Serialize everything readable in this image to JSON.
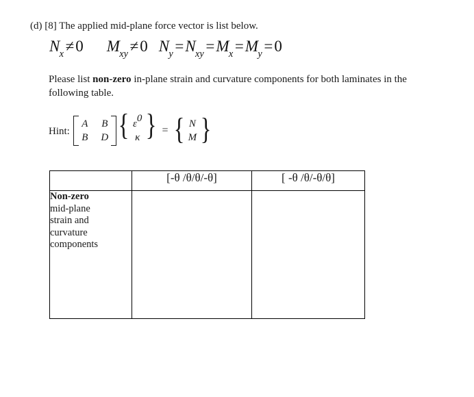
{
  "document": {
    "question_prefix": "(d) [8] The applied mid-plane force vector is list below.",
    "instruction_part1": "Please list ",
    "instruction_bold": "non-zero",
    "instruction_part2": " in-plane strain and curvature components for both laminates in the following table.",
    "hint_label": "Hint:"
  },
  "force_equation": {
    "term1": {
      "symbol": "N",
      "subscript": "x",
      "operator": "≠",
      "value": "0"
    },
    "term2": {
      "symbol": "M",
      "subscript": "xy",
      "operator": "≠",
      "value": "0"
    },
    "term3": {
      "symbol": "N",
      "subscript": "y"
    },
    "term4": {
      "symbol": "N",
      "subscript": "xy"
    },
    "term5": {
      "symbol": "M",
      "subscript": "x"
    },
    "term6": {
      "symbol": "M",
      "subscript": "y"
    },
    "equals": "=",
    "zero": "0"
  },
  "hint_equation": {
    "matrix": {
      "a11": "A",
      "a12": "B",
      "a21": "B",
      "a22": "D"
    },
    "strain_vector": {
      "top": "ε",
      "top_superscript": "0",
      "bottom": "κ"
    },
    "load_vector": {
      "top": "N",
      "bottom": "M"
    },
    "equals": "=",
    "left_bracket": "[",
    "right_bracket": "]",
    "left_brace": "{",
    "right_brace": "}"
  },
  "table": {
    "headers": [
      "",
      "[-θ /θ/θ/-θ]",
      "[ -θ /θ/-θ/θ]"
    ],
    "row_label_bold": "Non-zero",
    "row_label_rest": "mid-plane strain and curvature components",
    "row_label_lines": [
      "Non-zero",
      "mid-plane",
      "strain and",
      "curvature",
      "components"
    ],
    "cells": [
      "",
      ""
    ]
  },
  "colors": {
    "text": "#1a1a1a",
    "border": "#000000",
    "background": "#ffffff"
  }
}
